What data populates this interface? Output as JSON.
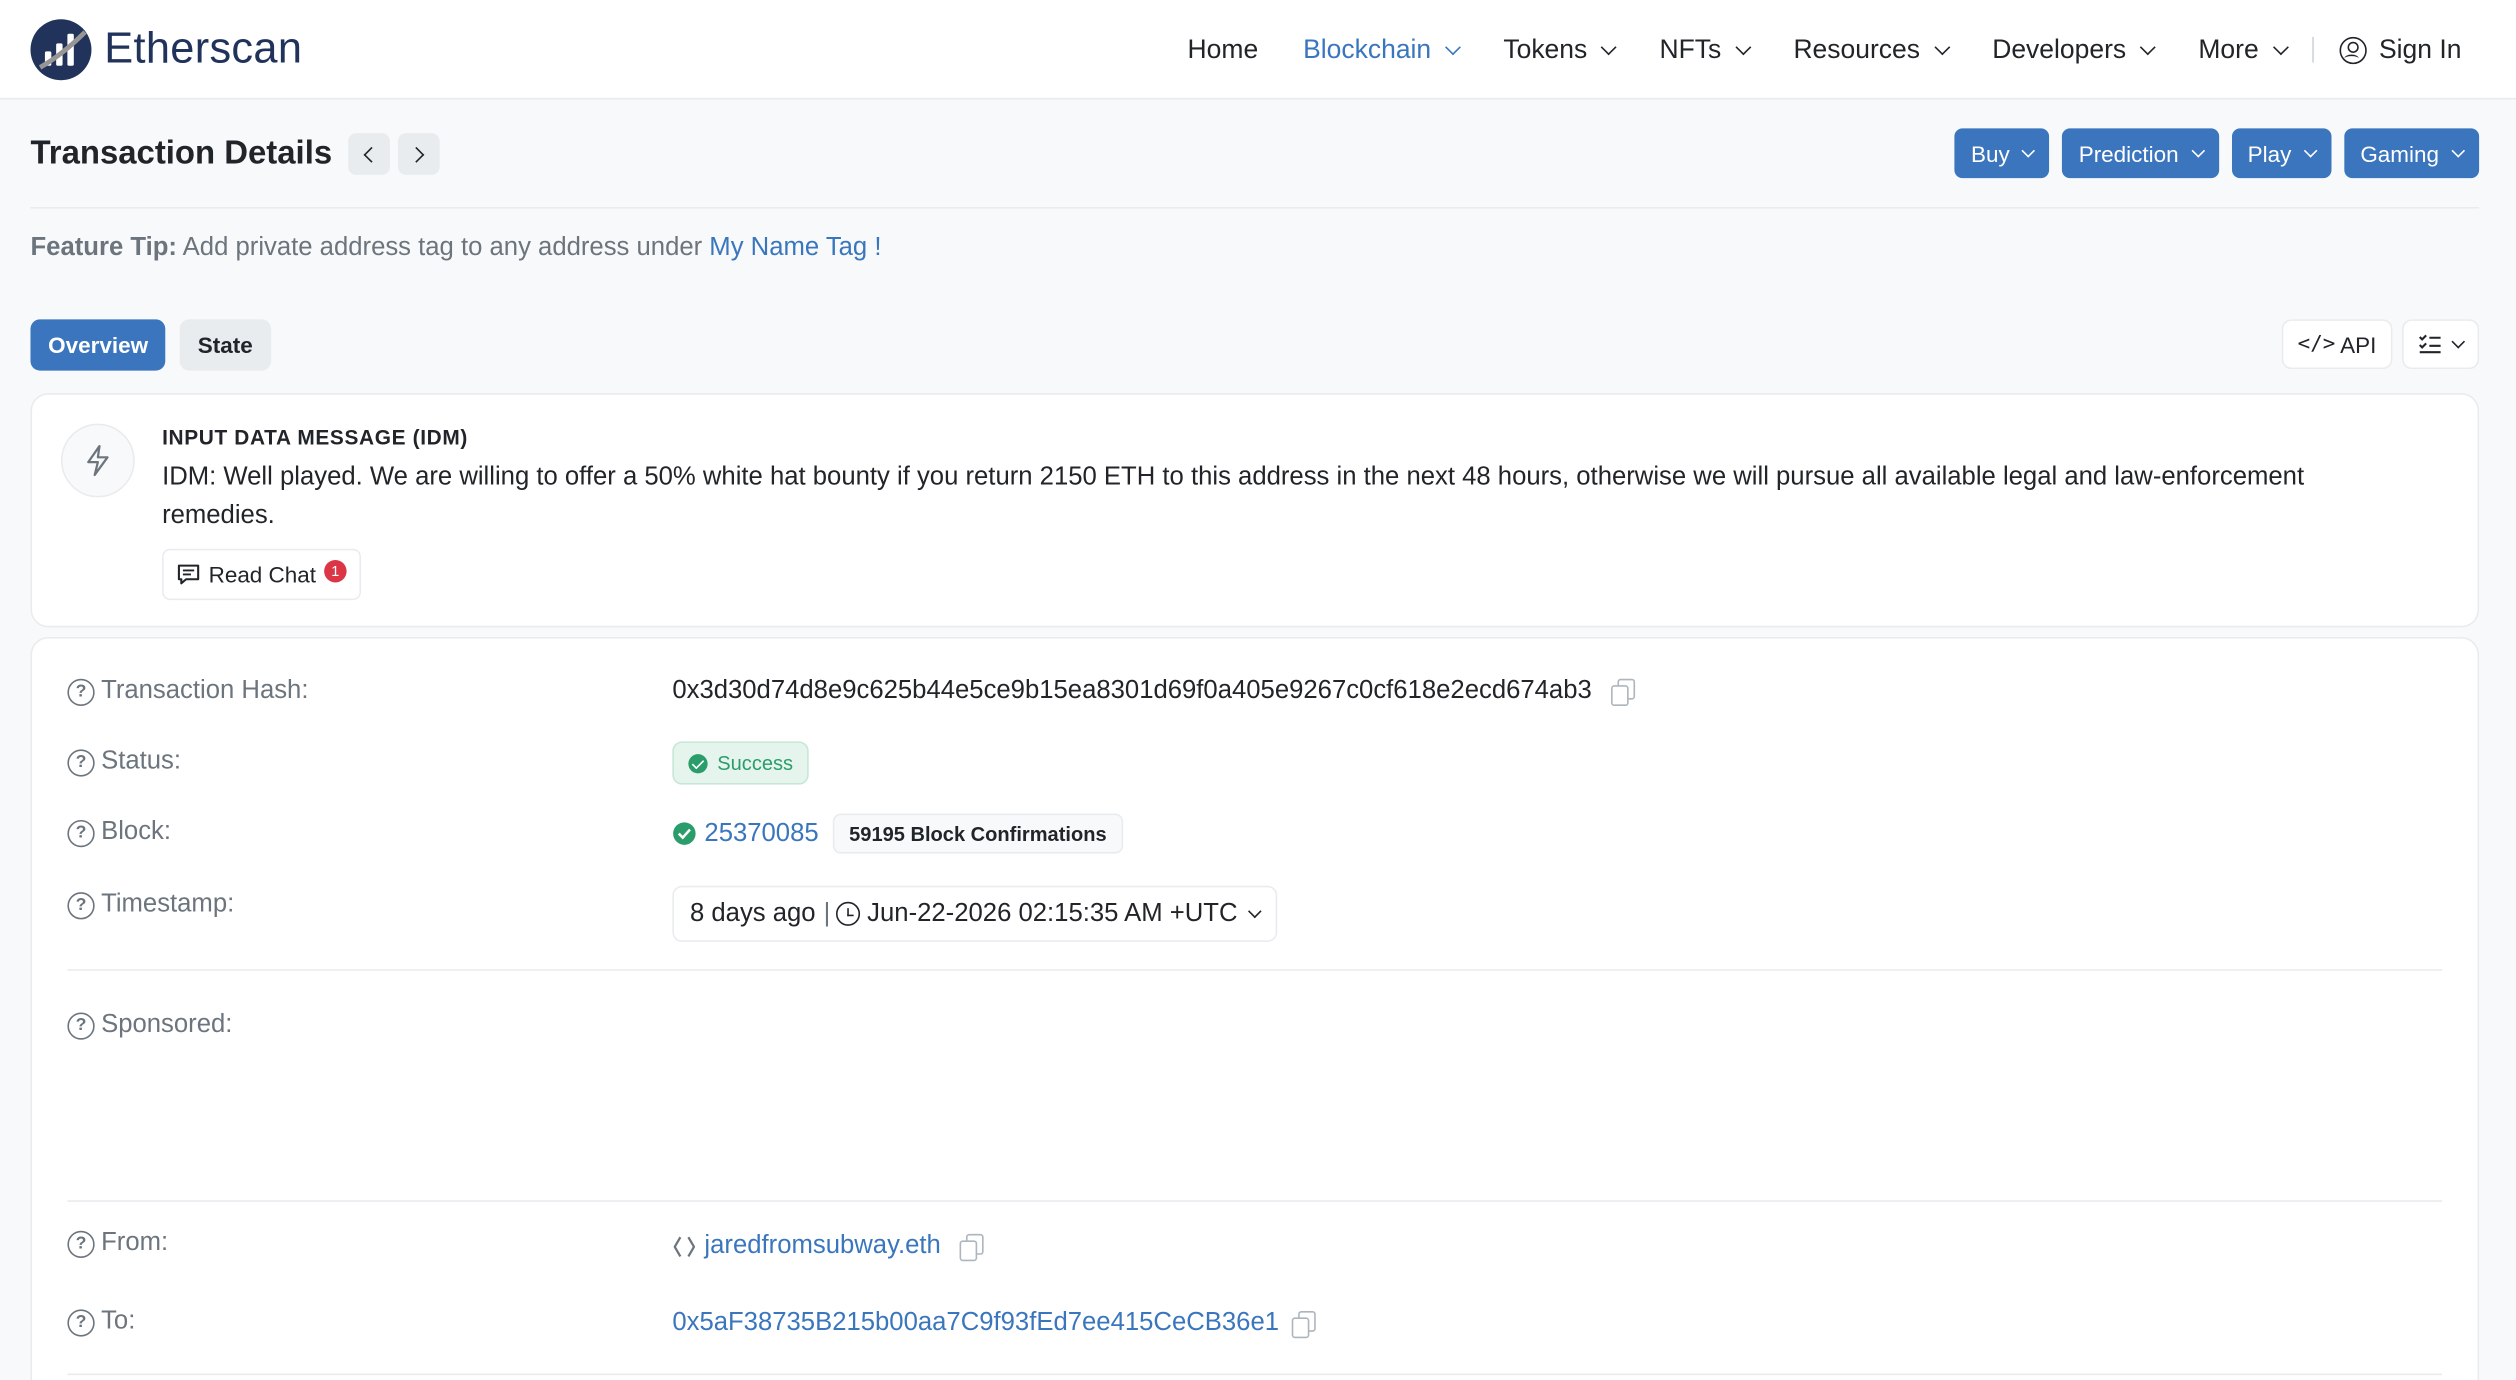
{
  "header": {
    "logo_text": "Etherscan",
    "nav": [
      {
        "label": "Home",
        "dropdown": false
      },
      {
        "label": "Blockchain",
        "dropdown": true,
        "active": true
      },
      {
        "label": "Tokens",
        "dropdown": true
      },
      {
        "label": "NFTs",
        "dropdown": true
      },
      {
        "label": "Resources",
        "dropdown": true
      },
      {
        "label": "Developers",
        "dropdown": true
      },
      {
        "label": "More",
        "dropdown": true
      }
    ],
    "sign_in": "Sign In"
  },
  "page": {
    "title": "Transaction Details",
    "promo_buttons": [
      "Buy",
      "Prediction",
      "Play",
      "Gaming"
    ]
  },
  "tip": {
    "label": "Feature Tip:",
    "text": " Add private address tag to any address under ",
    "link": "My Name Tag !"
  },
  "tabs": [
    {
      "label": "Overview",
      "active": true
    },
    {
      "label": "State",
      "active": false
    }
  ],
  "tools": {
    "api_label": "API"
  },
  "idm": {
    "title": "INPUT DATA MESSAGE (IDM)",
    "message": "IDM: Well played. We are willing to offer a 50% white hat bounty if you return 2150 ETH to this address in the next 48 hours, otherwise we will pursue all available legal and law-enforcement remedies.",
    "read_chat": "Read Chat",
    "chat_count": "1"
  },
  "details": {
    "tx_hash_label": "Transaction Hash:",
    "tx_hash": "0x3d30d74d8e9c625b44e5ce9b15ea8301d69f0a405e9267c0cf618e2ecd674ab3",
    "status_label": "Status:",
    "status": "Success",
    "block_label": "Block:",
    "block": "25370085",
    "confirmations": "59195 Block Confirmations",
    "timestamp_label": "Timestamp:",
    "timestamp_relative": "8 days ago",
    "timestamp_sep": "|",
    "timestamp": "Jun-22-2026 02:15:35 AM +UTC",
    "sponsored_label": "Sponsored:",
    "from_label": "From:",
    "from": "jaredfromsubway.eth",
    "to_label": "To:",
    "to": "0x5aF38735B215b00aa7C9f93fEd7ee415CeCB36e1"
  },
  "colors": {
    "accent": "#3b75bd",
    "link": "#3a76bd",
    "success": "#2a9d6b",
    "brand": "#21325b"
  }
}
